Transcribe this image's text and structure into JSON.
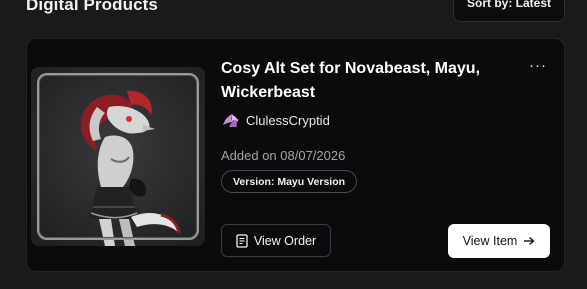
{
  "section": {
    "title": "Digital Products"
  },
  "sort": {
    "label": "Sort by: Latest"
  },
  "product": {
    "title": "Cosy Alt Set for Novabeast, Mayu, Wickerbeast",
    "creator": "ClulessCryptid",
    "added": "Added on 08/07/2026",
    "version": "Version: Mayu Version",
    "more_label": "···",
    "thumbnail_icon": "character-render-image",
    "accent_color": "#b3262b"
  },
  "actions": {
    "view_order_label": "View Order",
    "view_order_icon": "receipt-icon",
    "view_item_label": "View Item",
    "view_item_icon": "arrow-right-icon"
  }
}
